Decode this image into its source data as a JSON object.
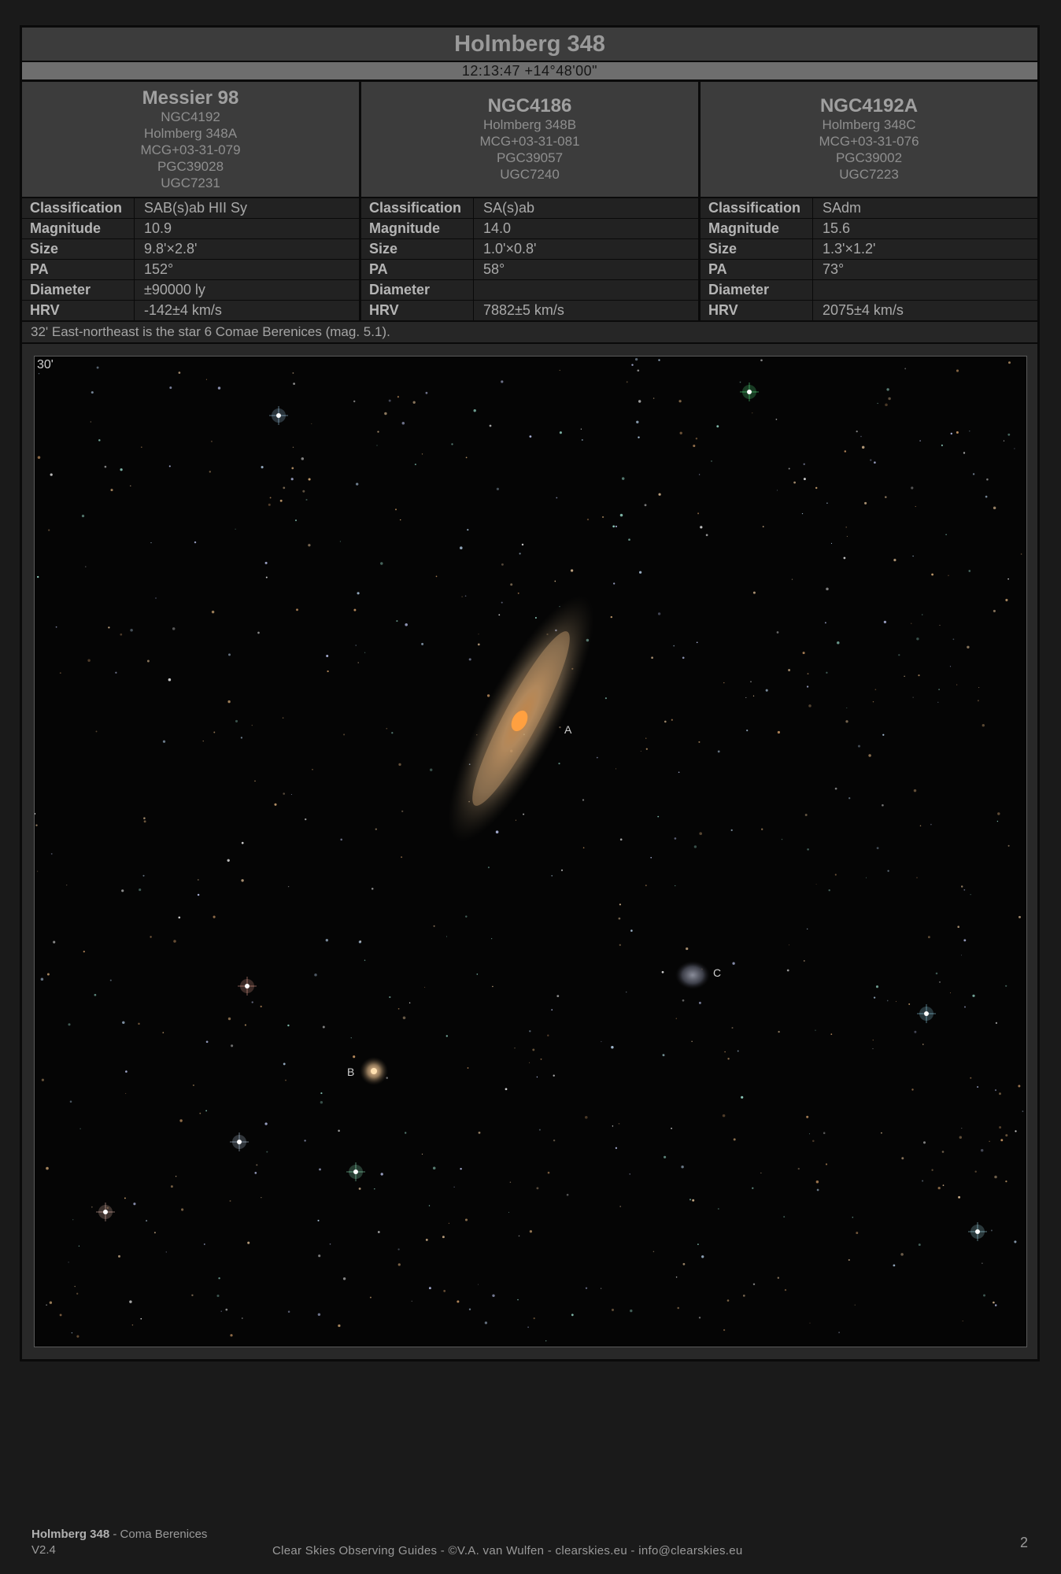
{
  "title": "Holmberg 348",
  "coordinates": "12:13:47 +14°48'00\"",
  "objects": [
    {
      "name": "Messier 98",
      "aliases": [
        "NGC4192",
        "Holmberg 348A",
        "MCG+03-31-079",
        "PGC39028",
        "UGC7231"
      ],
      "properties": [
        {
          "label": "Classification",
          "value": "SAB(s)ab HII Sy"
        },
        {
          "label": "Magnitude",
          "value": "10.9"
        },
        {
          "label": "Size",
          "value": "9.8'×2.8'"
        },
        {
          "label": "PA",
          "value": "152°"
        },
        {
          "label": "Diameter",
          "value": "±90000 ly"
        },
        {
          "label": "HRV",
          "value": "-142±4 km/s"
        }
      ]
    },
    {
      "name": "NGC4186",
      "aliases": [
        "Holmberg 348B",
        "MCG+03-31-081",
        "PGC39057",
        "UGC7240"
      ],
      "properties": [
        {
          "label": "Classification",
          "value": "SA(s)ab"
        },
        {
          "label": "Magnitude",
          "value": "14.0"
        },
        {
          "label": "Size",
          "value": "1.0'×0.8'"
        },
        {
          "label": "PA",
          "value": "58°"
        },
        {
          "label": "Diameter",
          "value": ""
        },
        {
          "label": "HRV",
          "value": "7882±5 km/s"
        }
      ]
    },
    {
      "name": "NGC4192A",
      "aliases": [
        "Holmberg 348C",
        "MCG+03-31-076",
        "PGC39002",
        "UGC7223"
      ],
      "properties": [
        {
          "label": "Classification",
          "value": "SAdm"
        },
        {
          "label": "Magnitude",
          "value": "15.6"
        },
        {
          "label": "Size",
          "value": "1.3'×1.2'"
        },
        {
          "label": "PA",
          "value": "73°"
        },
        {
          "label": "Diameter",
          "value": ""
        },
        {
          "label": "HRV",
          "value": "2075±4 km/s"
        }
      ]
    }
  ],
  "note": "32' East-northeast is the star 6 Comae Berenices (mag. 5.1).",
  "image": {
    "scale_label": "30'",
    "markers": [
      "A",
      "B",
      "C"
    ]
  },
  "footer": {
    "object": "Holmberg 348",
    "constellation": " - Coma Berenices",
    "version": "V2.4",
    "credits": "Clear Skies Observing Guides - ©V.A. van Wulfen - clearskies.eu - info@clearskies.eu",
    "page": "2"
  }
}
